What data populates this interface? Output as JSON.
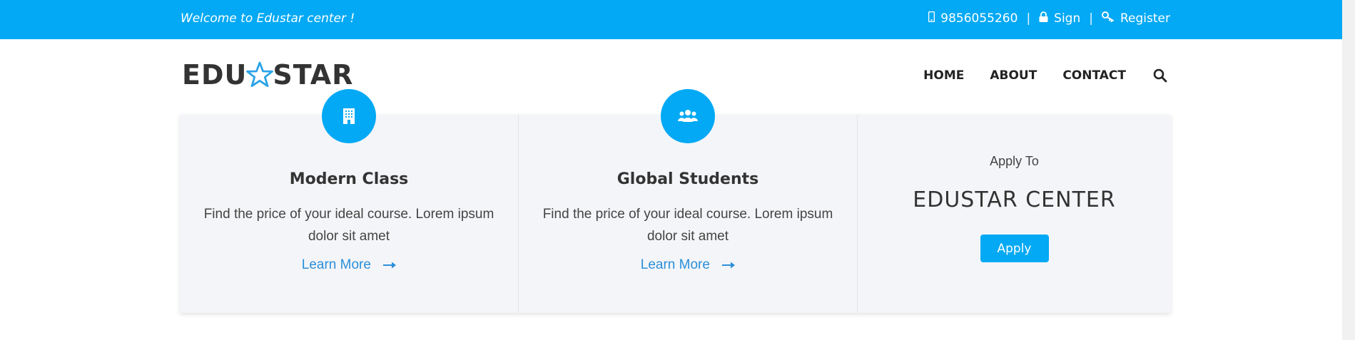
{
  "topbar": {
    "welcome": "Welcome to Edustar center !",
    "phone": "9856055260",
    "sign": "Sign",
    "register": "Register",
    "separator": "|"
  },
  "header": {
    "logo_left": "EDU",
    "logo_right": "STAR",
    "nav": [
      "HOME",
      "ABOUT",
      "CONTACT"
    ]
  },
  "cards": [
    {
      "icon": "building-icon",
      "title": "Modern Class",
      "desc": "Find the price of your ideal course. Lorem ipsum dolor sit amet",
      "link": "Learn More"
    },
    {
      "icon": "users-icon",
      "title": "Global Students",
      "desc": "Find the price of your ideal course. Lorem ipsum dolor sit amet",
      "link": "Learn More"
    }
  ],
  "apply": {
    "label": "Apply To",
    "title": "EDUSTAR CENTER",
    "button": "Apply"
  },
  "colors": {
    "accent": "#03a9f4",
    "panel_bg": "#f4f5f8",
    "link": "#2b8fd9",
    "text_dark": "#333333"
  }
}
